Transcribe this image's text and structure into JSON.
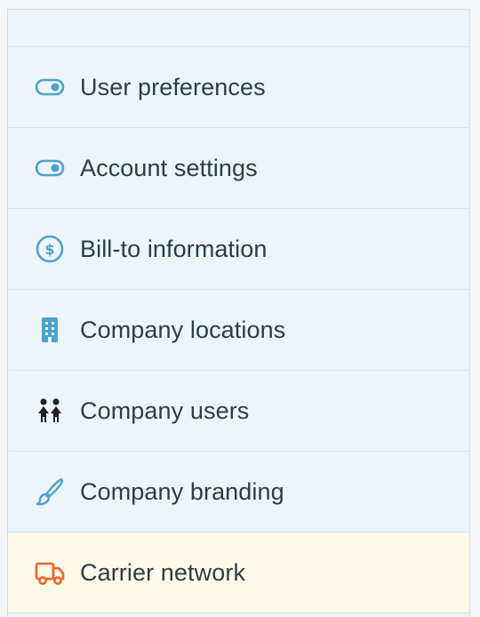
{
  "sidebar": {
    "items": [
      {
        "label": "User preferences",
        "icon": "toggle-icon"
      },
      {
        "label": "Account settings",
        "icon": "toggle-icon"
      },
      {
        "label": "Bill-to information",
        "icon": "dollar-circle-icon"
      },
      {
        "label": "Company locations",
        "icon": "building-icon"
      },
      {
        "label": "Company users",
        "icon": "people-icon"
      },
      {
        "label": "Company branding",
        "icon": "paintbrush-icon"
      },
      {
        "label": "Carrier network",
        "icon": "truck-icon",
        "active": true
      }
    ]
  },
  "colors": {
    "sidebar_bg": "#eef5fa",
    "active_bg": "#fdfbe8",
    "icon_blue": "#4ba3d0",
    "icon_orange": "#f0642a",
    "icon_dark": "#222222",
    "text": "#2f3b45"
  }
}
